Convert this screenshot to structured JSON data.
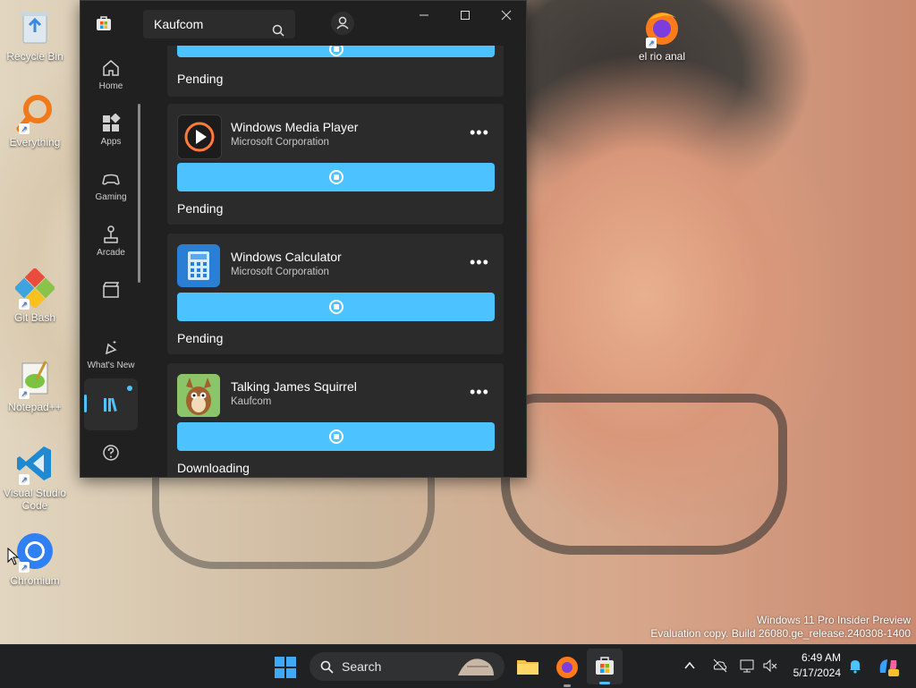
{
  "desktop": {
    "icons": [
      {
        "label": "Recycle Bin"
      },
      {
        "label": "Everything"
      },
      {
        "label": "Git Bash"
      },
      {
        "label": "Notepad++"
      },
      {
        "label": "Visual Studio Code"
      },
      {
        "label": "Chromium"
      },
      {
        "label": "el rio anal"
      }
    ],
    "watermark": {
      "line1": "Windows 11 Pro Insider Preview",
      "line2": "Evaluation copy. Build 26080.ge_release.240308-1400"
    }
  },
  "store": {
    "search_value": "Kaufcom",
    "nav": [
      {
        "label": "Home",
        "icon": "home-icon"
      },
      {
        "label": "Apps",
        "icon": "apps-icon"
      },
      {
        "label": "Gaming",
        "icon": "gamepad-icon"
      },
      {
        "label": "Arcade",
        "icon": "joystick-icon"
      },
      {
        "label": "",
        "icon": "film-icon"
      },
      {
        "label": "What's New",
        "icon": "sparkle-bell-icon"
      },
      {
        "label": "",
        "icon": "library-icon"
      },
      {
        "label": "",
        "icon": "help-icon"
      }
    ],
    "items": [
      {
        "name": "",
        "publisher": "",
        "status": "Pending"
      },
      {
        "name": "Windows Media Player",
        "publisher": "Microsoft Corporation",
        "status": "Pending"
      },
      {
        "name": "Windows Calculator",
        "publisher": "Microsoft Corporation",
        "status": "Pending"
      },
      {
        "name": "Talking James Squirrel",
        "publisher": "Kaufcom",
        "status": "Downloading"
      }
    ],
    "more_label": "•••"
  },
  "taskbar": {
    "search_placeholder": "Search",
    "time": "6:49 AM",
    "date": "5/17/2024"
  },
  "colors": {
    "accent": "#4cc2ff",
    "window_bg": "#202020",
    "card_bg": "#2b2b2b"
  }
}
